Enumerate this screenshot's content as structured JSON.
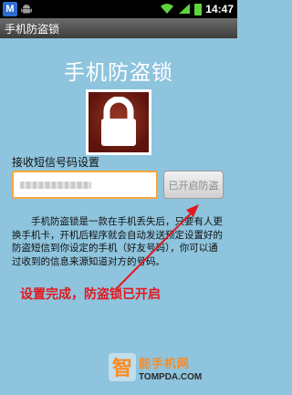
{
  "status_bar": {
    "time": "14:47",
    "colors": {
      "background": "#000000",
      "signal": "#5fd33c"
    }
  },
  "title_bar": {
    "title": "手机防盗锁"
  },
  "main": {
    "heading": "手机防盗锁",
    "setting_label": "接收短信号码设置",
    "enabled_button_label": "已开启防盗",
    "description": "手机防盗锁是一款在手机丢失后，只要有人更换手机卡，开机后程序就会自动发送预定设置好的防盗短信到你设定的手机（好友号码），你可以通过收到的信息来源知道对方的号码。"
  },
  "annotation": {
    "text": "设置完成，防盗锁已开启",
    "color": "#e3171e"
  },
  "watermark": {
    "site_name": "能手机网",
    "url": "TOMPDA.COM",
    "logo_char": "智"
  },
  "colors": {
    "background": "#8ec4dd",
    "input_border": "#f6a83a",
    "lock_tile": "#7a2214"
  }
}
